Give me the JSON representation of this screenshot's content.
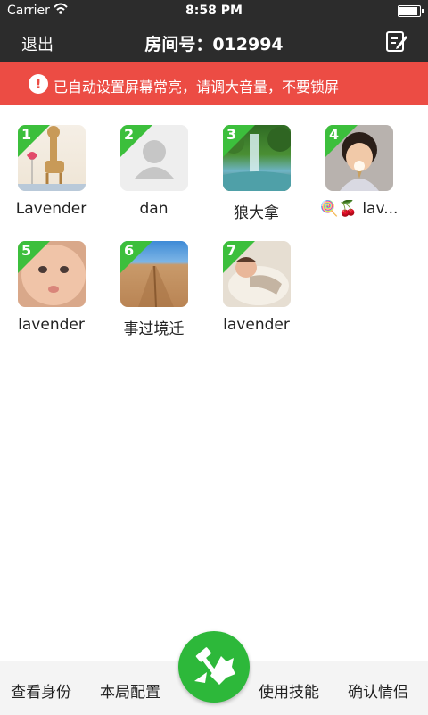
{
  "status_bar": {
    "carrier": "Carrier",
    "time": "8:58 PM"
  },
  "nav": {
    "exit_label": "退出",
    "title": "房间号：012994",
    "edit_icon": "edit-icon"
  },
  "alert": {
    "text": "已自动设置屏幕常亮，请调大音量，不要锁屏",
    "icon": "exclamation-icon"
  },
  "players": [
    {
      "num": "1",
      "name": "Lavender",
      "avatar": "giraffe"
    },
    {
      "num": "2",
      "name": "dan",
      "avatar": "default"
    },
    {
      "num": "3",
      "name": "狼大拿",
      "avatar": "waterfall"
    },
    {
      "num": "4",
      "name": "🍭🍒 lav...",
      "avatar": "girl-icecream"
    },
    {
      "num": "5",
      "name": "lavender",
      "avatar": "baby"
    },
    {
      "num": "6",
      "name": "事过境迁",
      "avatar": "desert"
    },
    {
      "num": "7",
      "name": "lavender",
      "avatar": "sleeping-child"
    }
  ],
  "bottom": {
    "view_identity": "查看身份",
    "game_config": "本局配置",
    "use_skill": "使用技能",
    "confirm_lover": "确认情侣",
    "center_icon": "wolf-hammer-icon"
  },
  "colors": {
    "dark": "#2c2c2c",
    "alert": "#ec4c44",
    "badge": "#3cbf3c",
    "fab": "#2db83a"
  }
}
